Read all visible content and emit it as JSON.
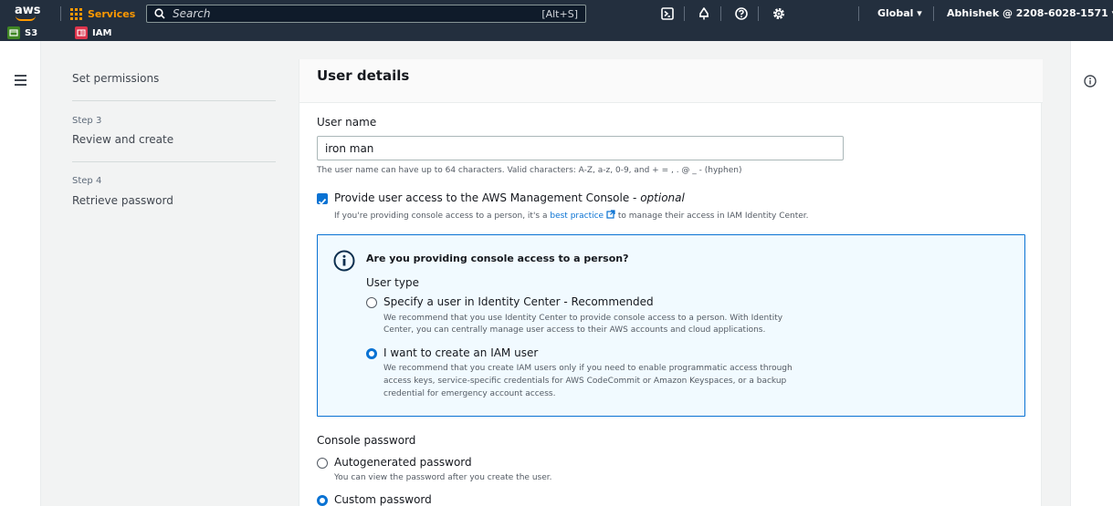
{
  "topbar": {
    "logo_text": "aws",
    "services_label": "Services",
    "search_placeholder": "Search",
    "search_shortcut": "[Alt+S]",
    "region": "Global ▾",
    "account": "Abhishek @ 2208-6028-1571 ▾",
    "favorites": [
      {
        "label": "S3",
        "icon": "s3-icon",
        "color": "#3f8624"
      },
      {
        "label": "IAM",
        "icon": "iam-icon",
        "color": "#dd344c"
      }
    ]
  },
  "steps": {
    "step2_label": "Set permissions",
    "step3_small": "Step 3",
    "step3_label": "Review and create",
    "step4_small": "Step 4",
    "step4_label": "Retrieve password"
  },
  "panel": {
    "title": "User details",
    "username_label": "User name",
    "username_value": "iron man",
    "username_hint": "The user name can have up to 64 characters. Valid characters: A-Z, a-z, 0-9, and + = , . @ _ - (hyphen)",
    "console_access_label": "Provide user access to the AWS Management Console - ",
    "console_access_optional": "optional",
    "console_access_hint_pre": "If you're providing console access to a person, it's a ",
    "console_access_hint_link": "best practice",
    "console_access_hint_post": " to manage their access in IAM Identity Center.",
    "info": {
      "title": "Are you providing console access to a person?",
      "user_type_label": "User type",
      "option1_label": "Specify a user in Identity Center - Recommended",
      "option1_desc_1": "We recommend that you use Identity Center to provide console access to a person. With Identity",
      "option1_desc_2": "Center, you can centrally manage user access to their AWS accounts and cloud applications.",
      "option2_label": "I want to create an IAM user",
      "option2_desc_1": "We recommend that you create IAM users only if you need to enable programmatic access through",
      "option2_desc_2": "access keys, service-specific credentials for AWS CodeCommit or Amazon Keyspaces, or a backup",
      "option2_desc_3": "credential for emergency account access."
    },
    "password_label": "Console password",
    "pw_option1_label": "Autogenerated password",
    "pw_option1_desc": "You can view the password after you create the user.",
    "pw_option2_label": "Custom password"
  }
}
